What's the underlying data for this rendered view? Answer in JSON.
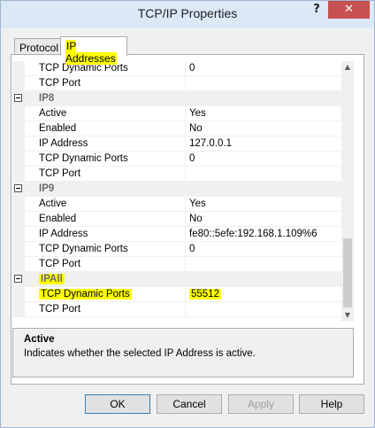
{
  "window": {
    "title": "TCP/IP Properties",
    "help_glyph": "?",
    "close_glyph": "✕"
  },
  "tabs": [
    {
      "label": "Protocol"
    },
    {
      "label": "IP Addresses"
    }
  ],
  "grid": {
    "rows": [
      {
        "kind": "prop",
        "name": "TCP Dynamic Ports",
        "value": "0"
      },
      {
        "kind": "prop",
        "name": "TCP Port",
        "value": ""
      },
      {
        "kind": "cat",
        "name": "IP8"
      },
      {
        "kind": "prop",
        "name": "Active",
        "value": "Yes"
      },
      {
        "kind": "prop",
        "name": "Enabled",
        "value": "No"
      },
      {
        "kind": "prop",
        "name": "IP Address",
        "value": "127.0.0.1"
      },
      {
        "kind": "prop",
        "name": "TCP Dynamic Ports",
        "value": "0"
      },
      {
        "kind": "prop",
        "name": "TCP Port",
        "value": ""
      },
      {
        "kind": "cat",
        "name": "IP9"
      },
      {
        "kind": "prop",
        "name": "Active",
        "value": "Yes"
      },
      {
        "kind": "prop",
        "name": "Enabled",
        "value": "No"
      },
      {
        "kind": "prop",
        "name": "IP Address",
        "value": "fe80::5efe:192.168.1.109%6"
      },
      {
        "kind": "prop",
        "name": "TCP Dynamic Ports",
        "value": "0"
      },
      {
        "kind": "prop",
        "name": "TCP Port",
        "value": ""
      },
      {
        "kind": "cat",
        "name": "IPAll"
      },
      {
        "kind": "prop",
        "name": "TCP Dynamic Ports",
        "value": "55512"
      },
      {
        "kind": "prop",
        "name": "TCP Port",
        "value": ""
      }
    ]
  },
  "description": {
    "title": "Active",
    "text": "Indicates whether the selected IP Address is active."
  },
  "buttons": {
    "ok": "OK",
    "cancel": "Cancel",
    "apply": "Apply",
    "help": "Help"
  },
  "scrollbar": {
    "up_glyph": "▲",
    "down_glyph": "▼"
  },
  "colors": {
    "highlight": "#ffff00",
    "close": "#c75050"
  }
}
